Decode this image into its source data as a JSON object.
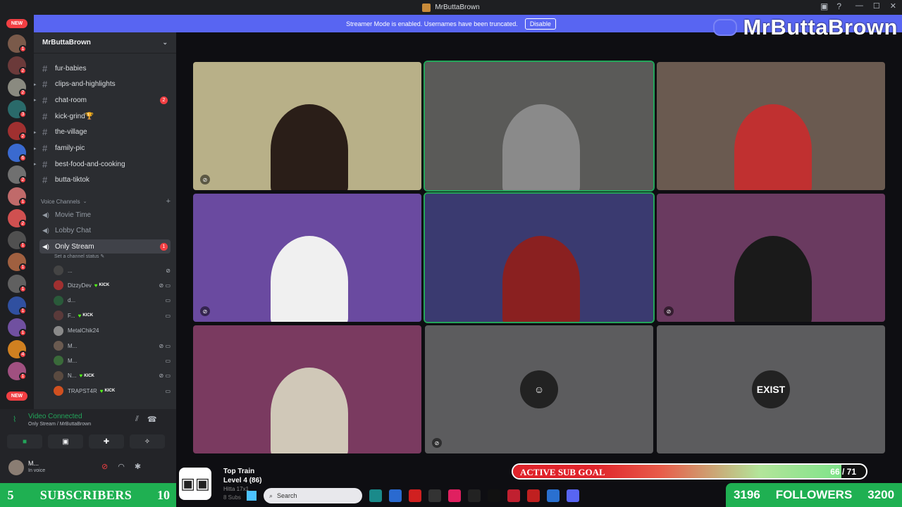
{
  "window": {
    "title": "MrButtaBrown"
  },
  "banner": {
    "text": "Streamer Mode is enabled. Usernames have been truncated.",
    "disable_label": "Disable"
  },
  "brand": {
    "name": "MrButtaBrown"
  },
  "rail": {
    "new_top": "NEW",
    "new_bottom": "NEW",
    "servers": [
      {
        "badge": "1",
        "color": "#7a5a4a"
      },
      {
        "badge": "2",
        "color": "#6b3a3a"
      },
      {
        "badge": "2",
        "color": "#8a8a80"
      },
      {
        "badge": "3",
        "color": "#2a6a6a"
      },
      {
        "badge": "2",
        "color": "#a03030"
      },
      {
        "badge": "6",
        "color": "#3a6ad0"
      },
      {
        "badge": "2",
        "color": "#707070"
      },
      {
        "badge": "1",
        "color": "#c06a6a"
      },
      {
        "badge": "2",
        "color": "#d05050"
      },
      {
        "badge": "1",
        "color": "#505050"
      },
      {
        "badge": "1",
        "color": "#a06040"
      },
      {
        "badge": "1",
        "color": "#606060"
      },
      {
        "badge": "1",
        "color": "#3050a0"
      },
      {
        "badge": "1",
        "color": "#7050a0"
      },
      {
        "badge": "4",
        "color": "#d08020"
      },
      {
        "badge": "1",
        "color": "#a05080"
      }
    ]
  },
  "server": {
    "name": "MrButtaBrown"
  },
  "channels": [
    {
      "name": "fur-babies",
      "unread": ""
    },
    {
      "name": "clips-and-highlights",
      "unread": ""
    },
    {
      "name": "chat-room",
      "unread": "2"
    },
    {
      "name": "kick-grind🏆",
      "unread": ""
    },
    {
      "name": "the-village",
      "unread": ""
    },
    {
      "name": "family-pic",
      "unread": ""
    },
    {
      "name": "best-food-and-cooking",
      "unread": ""
    },
    {
      "name": "butta-tiktok",
      "unread": ""
    }
  ],
  "voice_section": {
    "title": "Voice Channels",
    "add": "+"
  },
  "voice_channels": [
    {
      "name": "Movie Time",
      "unread": ""
    },
    {
      "name": "Lobby Chat",
      "unread": ""
    },
    {
      "name": "Only Stream",
      "unread": "1"
    }
  ],
  "channel_status": "Set a channel status ✎",
  "voice_users": [
    {
      "name": "...",
      "kick": "",
      "icons": "⊘",
      "color": "#444"
    },
    {
      "name": "DizzyDev",
      "kick": "KICK",
      "icons": "⊘ ▭",
      "color": "#a03030"
    },
    {
      "name": "d...",
      "kick": "",
      "icons": "▭",
      "color": "#2a5a3a"
    },
    {
      "name": "F...",
      "kick": "KICK",
      "icons": "▭",
      "color": "#5a3a3a"
    },
    {
      "name": "MetalChik24",
      "kick": "",
      "icons": "",
      "color": "#8a8a8a"
    },
    {
      "name": "M...",
      "kick": "",
      "icons": "⊘ ▭",
      "color": "#6a5a50"
    },
    {
      "name": "M...",
      "kick": "",
      "icons": "▭",
      "color": "#3a6a3a"
    },
    {
      "name": "N...",
      "kick": "KICK",
      "icons": "⊘ ▭",
      "color": "#5a4a40"
    },
    {
      "name": "TRAPST4R",
      "kick": "KICK",
      "icons": "▭",
      "color": "#d05020"
    }
  ],
  "voice_connected": {
    "title": "Video Connected",
    "sub": "Only Stream / MrButtaBrown"
  },
  "user_panel": {
    "name": "M...",
    "status": "In voice"
  },
  "tiles": [
    {
      "name": "tile-1",
      "muted": true,
      "speaking": false,
      "bg": "#b8b088",
      "fg": "#2a1e18",
      "avatar": ""
    },
    {
      "name": "tile-2",
      "muted": false,
      "speaking": true,
      "bg": "#5a5a58",
      "fg": "#8a8a8a",
      "avatar": ""
    },
    {
      "name": "tile-3",
      "muted": false,
      "speaking": false,
      "bg": "#6a5a50",
      "fg": "#c03030",
      "avatar": ""
    },
    {
      "name": "tile-4",
      "muted": true,
      "speaking": false,
      "bg": "#6a4aa0",
      "fg": "#f0f0f0",
      "avatar": ""
    },
    {
      "name": "tile-5",
      "muted": false,
      "speaking": true,
      "bg": "#3a3a70",
      "fg": "#8a2020",
      "avatar": ""
    },
    {
      "name": "tile-6",
      "muted": true,
      "speaking": false,
      "bg": "#6a3a60",
      "fg": "#1a1a1a",
      "avatar": ""
    },
    {
      "name": "tile-7",
      "muted": false,
      "speaking": false,
      "bg": "#7a3a60",
      "fg": "#d0c8b8",
      "avatar": ""
    },
    {
      "name": "tile-8",
      "muted": true,
      "speaking": false,
      "bg": "#5c5c5e",
      "fg": "",
      "avatar": "☺"
    },
    {
      "name": "tile-9",
      "muted": false,
      "speaking": false,
      "bg": "#5c5c5e",
      "fg": "",
      "avatar": "EXIST"
    }
  ],
  "subs": {
    "left": "5",
    "label": "SUBSCRIBERS",
    "right": "10"
  },
  "followers": {
    "current": "3196",
    "label": "FOLLOWERS",
    "goal": "3200"
  },
  "sub_goal": {
    "label": "ACTIVE SUB GOAL",
    "count": "66 / 71",
    "progress": 0.93
  },
  "train": {
    "title": "Top Train",
    "level": "Level 4 (86)",
    "line3": "Hitta 17x1",
    "line4": "8 Subs"
  },
  "taskbar": {
    "search_placeholder": "Search",
    "apps": [
      {
        "name": "edge",
        "color": "#1a8a8a"
      },
      {
        "name": "store",
        "color": "#2a6ad0"
      },
      {
        "name": "youtube",
        "color": "#d02020"
      },
      {
        "name": "terminal",
        "color": "#333"
      },
      {
        "name": "tiktok",
        "color": "#e02060"
      },
      {
        "name": "github",
        "color": "#222"
      },
      {
        "name": "cod",
        "color": "#111"
      },
      {
        "name": "app",
        "color": "#c02030"
      },
      {
        "name": "opera",
        "color": "#c02020"
      },
      {
        "name": "chrome",
        "color": "#2a70d0"
      },
      {
        "name": "discord",
        "color": "#5865f2"
      }
    ]
  }
}
